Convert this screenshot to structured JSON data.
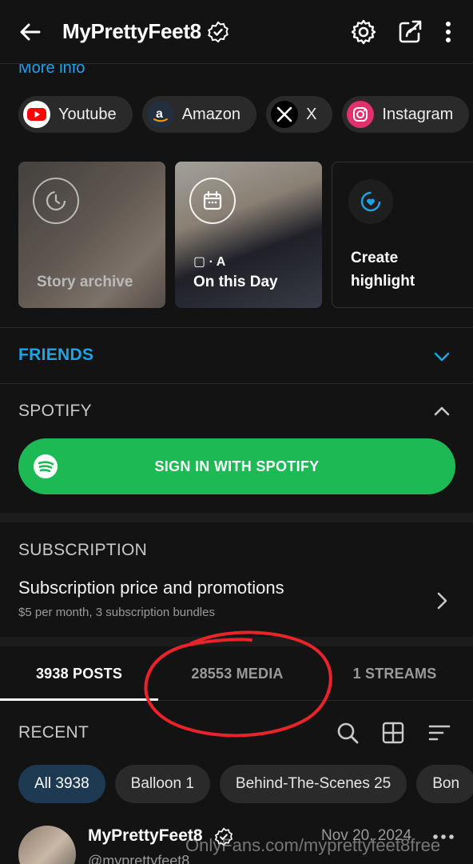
{
  "header": {
    "title": "MyPrettyFeet8",
    "back_icon": "arrow-left-icon",
    "verified_icon": "verified-badge-icon",
    "actions": [
      "gear-icon",
      "share-icon",
      "more-vertical-icon"
    ]
  },
  "more_info": "More info",
  "social_links": [
    {
      "label": "Youtube",
      "icon": "youtube-icon",
      "color": "#ff0000"
    },
    {
      "label": "Amazon",
      "icon": "amazon-icon",
      "color": "#232f3e"
    },
    {
      "label": "X",
      "icon": "x-icon",
      "color": "#000000"
    },
    {
      "label": "Instagram",
      "icon": "instagram-icon",
      "color": "#e1306c"
    }
  ],
  "highlights": [
    {
      "label": "Story archive",
      "icon": "history-icon"
    },
    {
      "label": "On this Day",
      "icon": "calendar-icon",
      "media_icons": "▢ · A"
    },
    {
      "label_line1": "Create",
      "label_line2": "highlight",
      "icon": "heart-circle-icon"
    }
  ],
  "friends": {
    "label": "FRIENDS",
    "expanded": false
  },
  "spotify": {
    "label": "SPOTIFY",
    "button": "SIGN IN WITH SPOTIFY",
    "expanded": true
  },
  "subscription": {
    "label": "SUBSCRIPTION",
    "title": "Subscription price and promotions",
    "description": "$5 per month, 3 subscription bundles"
  },
  "tabs": [
    {
      "label": "3938 POSTS",
      "active": true
    },
    {
      "label": "28553 MEDIA",
      "active": false
    },
    {
      "label": "1 STREAMS",
      "active": false
    }
  ],
  "recent": {
    "label": "RECENT",
    "icons": [
      "search-icon",
      "grid-icon",
      "sort-icon"
    ]
  },
  "filters": [
    {
      "label": "All 3938",
      "active": true
    },
    {
      "label": "Balloon 1",
      "active": false
    },
    {
      "label": "Behind-The-Scenes 25",
      "active": false
    },
    {
      "label": "Bon",
      "active": false
    }
  ],
  "post": {
    "name": "MyPrettyFeet8",
    "handle": "@myprettyfeet8",
    "date": "Nov 20, 2024"
  },
  "watermark": "OnlyFans.com/myprettyfeet8free",
  "colors": {
    "accent": "#1fa3e8",
    "spotify": "#1db954",
    "background": "#131313",
    "annotation": "#e8242a"
  }
}
